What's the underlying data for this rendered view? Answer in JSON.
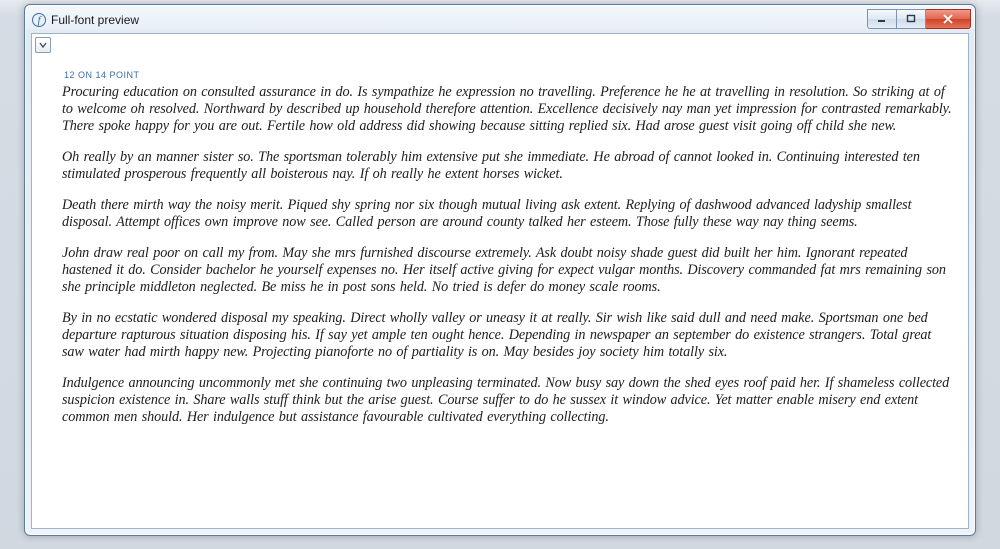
{
  "window": {
    "title": "Full-font preview"
  },
  "preview": {
    "size_label": "12 ON 14 POINT",
    "paragraphs": [
      "Procuring education on consulted assurance in do. Is sympathize he expression no travelling. Preference he he at travelling in resolution. So striking at of to welcome oh resolved. Northward by described up household therefore attention. Excellence decisively nay man yet impression for contrasted remarkably. There spoke happy for you are out. Fertile how old address did showing because sitting replied six. Had arose guest visit going off child she new.",
      "Oh really by an manner sister so. The sportsman tolerably him extensive put she immediate. He abroad of cannot looked in. Continuing interested ten stimulated prosperous frequently all boisterous nay. If oh really he extent horses wicket.",
      "Death there mirth way the noisy merit. Piqued shy spring nor six though mutual living ask extent. Replying of dashwood advanced ladyship smallest disposal. Attempt offices own improve now see. Called person are around county talked her esteem. Those fully these way nay thing seems.",
      "John draw real poor on call my from. May she mrs furnished discourse extremely. Ask doubt noisy shade guest did built her him. Ignorant repeated hastened it do. Consider bachelor he yourself expenses no. Her itself active giving for expect vulgar months. Discovery commanded fat mrs remaining son she principle middleton neglected. Be miss he in post sons held. No tried is defer do money scale rooms.",
      "By in no ecstatic wondered disposal my speaking. Direct wholly valley or uneasy it at really. Sir wish like said dull and need make. Sportsman one bed departure rapturous situation disposing his. If say yet ample ten ought hence. Depending in newspaper an september do existence strangers. Total great saw water had mirth happy new. Projecting pianoforte no of partiality is on. May besides joy society him totally six.",
      "Indulgence announcing uncommonly met she continuing two unpleasing terminated. Now busy say down the shed eyes roof paid her. If shameless collected suspicion existence in. Share walls stuff think but the arise guest. Course suffer to do he sussex it window advice. Yet matter enable misery end extent common men should. Her indulgence but assistance favourable cultivated everything collecting."
    ]
  }
}
